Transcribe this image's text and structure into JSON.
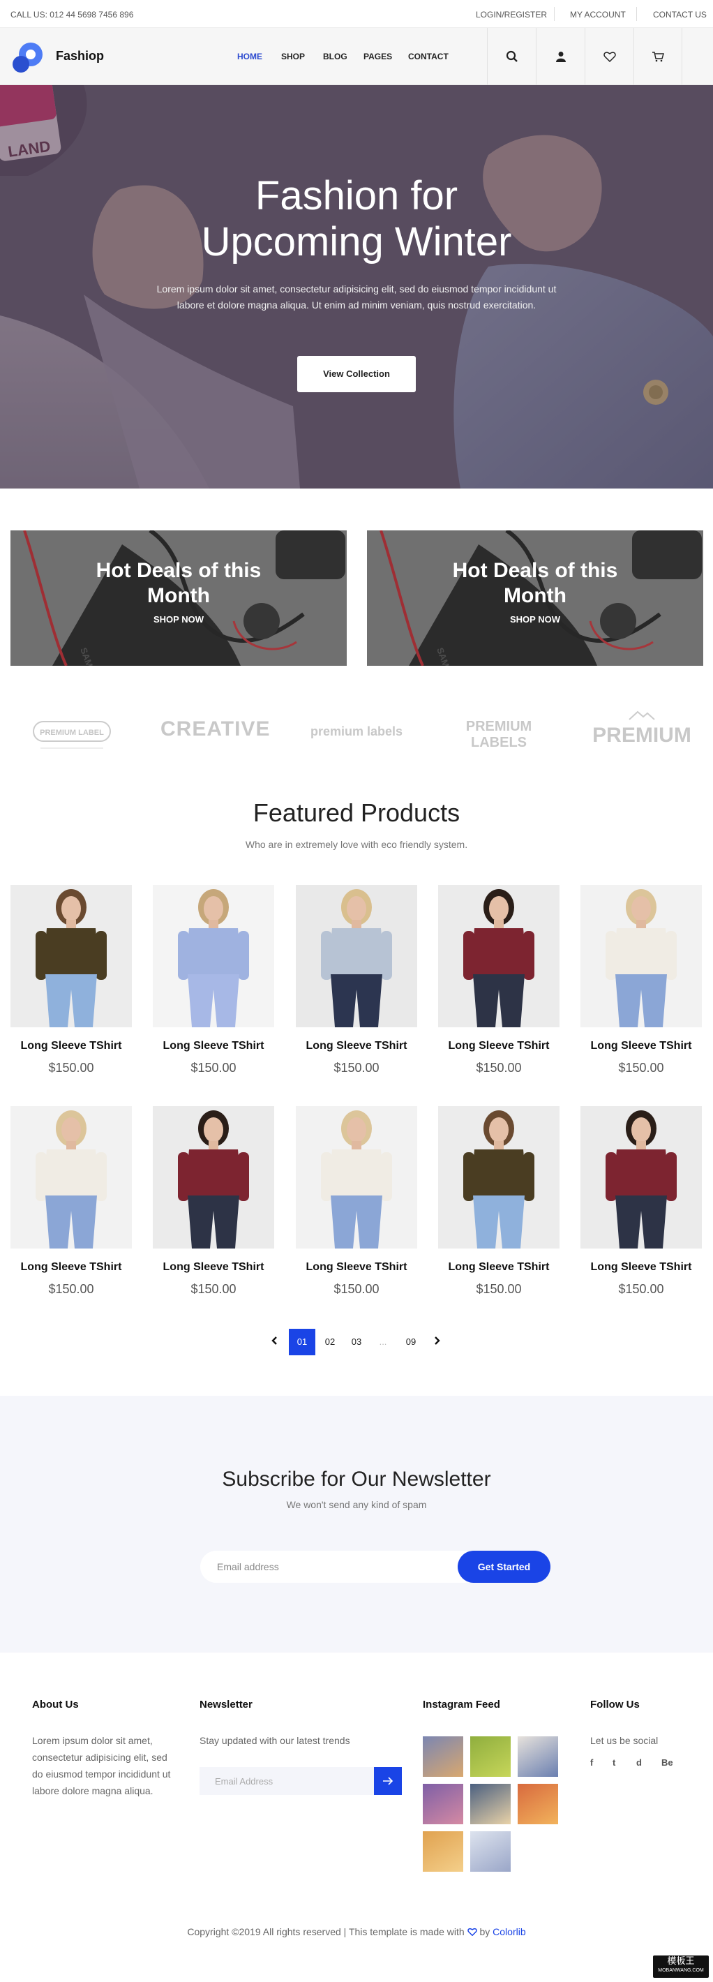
{
  "topbar": {
    "call": "CALL US: 012 44 5698 7456 896",
    "login": "LOGIN/REGISTER",
    "account": "MY ACCOUNT",
    "contact": "CONTACT US"
  },
  "header": {
    "brand": "Fashiop",
    "nav": [
      "HOME",
      "SHOP",
      "BLOG",
      "PAGES",
      "CONTACT"
    ],
    "accent": "#2d4bd0"
  },
  "hero": {
    "title_line1": "Fashion for",
    "title_line2": "Upcoming Winter",
    "text_line1": "Lorem ipsum dolor sit amet, consectetur adipisicing elit, sed do eiusmod tempor incididunt ut",
    "text_line2": "labore et dolore magna aliqua. Ut enim ad minim veniam, quis nostrud exercitation.",
    "button": "View Collection"
  },
  "promos": [
    {
      "title_line1": "Hot Deals of this",
      "title_line2": "Month",
      "cta": "SHOP NOW"
    },
    {
      "title_line1": "Hot Deals of this",
      "title_line2": "Month",
      "cta": "SHOP NOW"
    }
  ],
  "brands": [
    "PREMIUM LABEL",
    "CREATIVE",
    "premium labels",
    "PREMIUM LABELS",
    "PREMIUM"
  ],
  "featured": {
    "title": "Featured Products",
    "subtitle": "Who are in extremely love with eco friendly system."
  },
  "products": [
    {
      "name": "Long Sleeve TShirt",
      "price": "$150.00",
      "look": "tank"
    },
    {
      "name": "Long Sleeve TShirt",
      "price": "$150.00",
      "look": "ruffle"
    },
    {
      "name": "Long Sleeve TShirt",
      "price": "$150.00",
      "look": "shirt"
    },
    {
      "name": "Long Sleeve TShirt",
      "price": "$150.00",
      "look": "sweater"
    },
    {
      "name": "Long Sleeve TShirt",
      "price": "$150.00",
      "look": "vest"
    },
    {
      "name": "Long Sleeve TShirt",
      "price": "$150.00",
      "look": "vest"
    },
    {
      "name": "Long Sleeve TShirt",
      "price": "$150.00",
      "look": "sweater"
    },
    {
      "name": "Long Sleeve TShirt",
      "price": "$150.00",
      "look": "vest"
    },
    {
      "name": "Long Sleeve TShirt",
      "price": "$150.00",
      "look": "tank"
    },
    {
      "name": "Long Sleeve TShirt",
      "price": "$150.00",
      "look": "sweater"
    }
  ],
  "pagination": {
    "prev_icon": "chevron-left-icon",
    "pages": [
      "01",
      "02",
      "03",
      "...",
      "09"
    ],
    "active": "01",
    "next_icon": "chevron-right-icon"
  },
  "newsletter": {
    "title": "Subscribe for Our Newsletter",
    "subtitle": "We won't send any kind of spam",
    "placeholder": "Email address",
    "button": "Get Started"
  },
  "footer": {
    "about_title": "About Us",
    "about_text": [
      "Lorem ipsum dolor sit amet,",
      "consectetur adipisicing elit, sed",
      "do eiusmod tempor incididunt ut",
      "labore dolore magna aliqua."
    ],
    "news_title": "Newsletter",
    "news_text": "Stay updated with our latest trends",
    "news_placeholder": "Email Address",
    "insta_title": "Instagram Feed",
    "follow_title": "Follow Us",
    "follow_text": "Let us be social",
    "social": [
      "f",
      "t",
      "d",
      "Be"
    ],
    "copyright_pre": "Copyright ©2019 All rights reserved | This template is made with",
    "copyright_by": "by",
    "copyright_link": "Colorlib"
  },
  "watermark": {
    "line1": "模板王",
    "line2": "MOBANWANG.COM"
  }
}
